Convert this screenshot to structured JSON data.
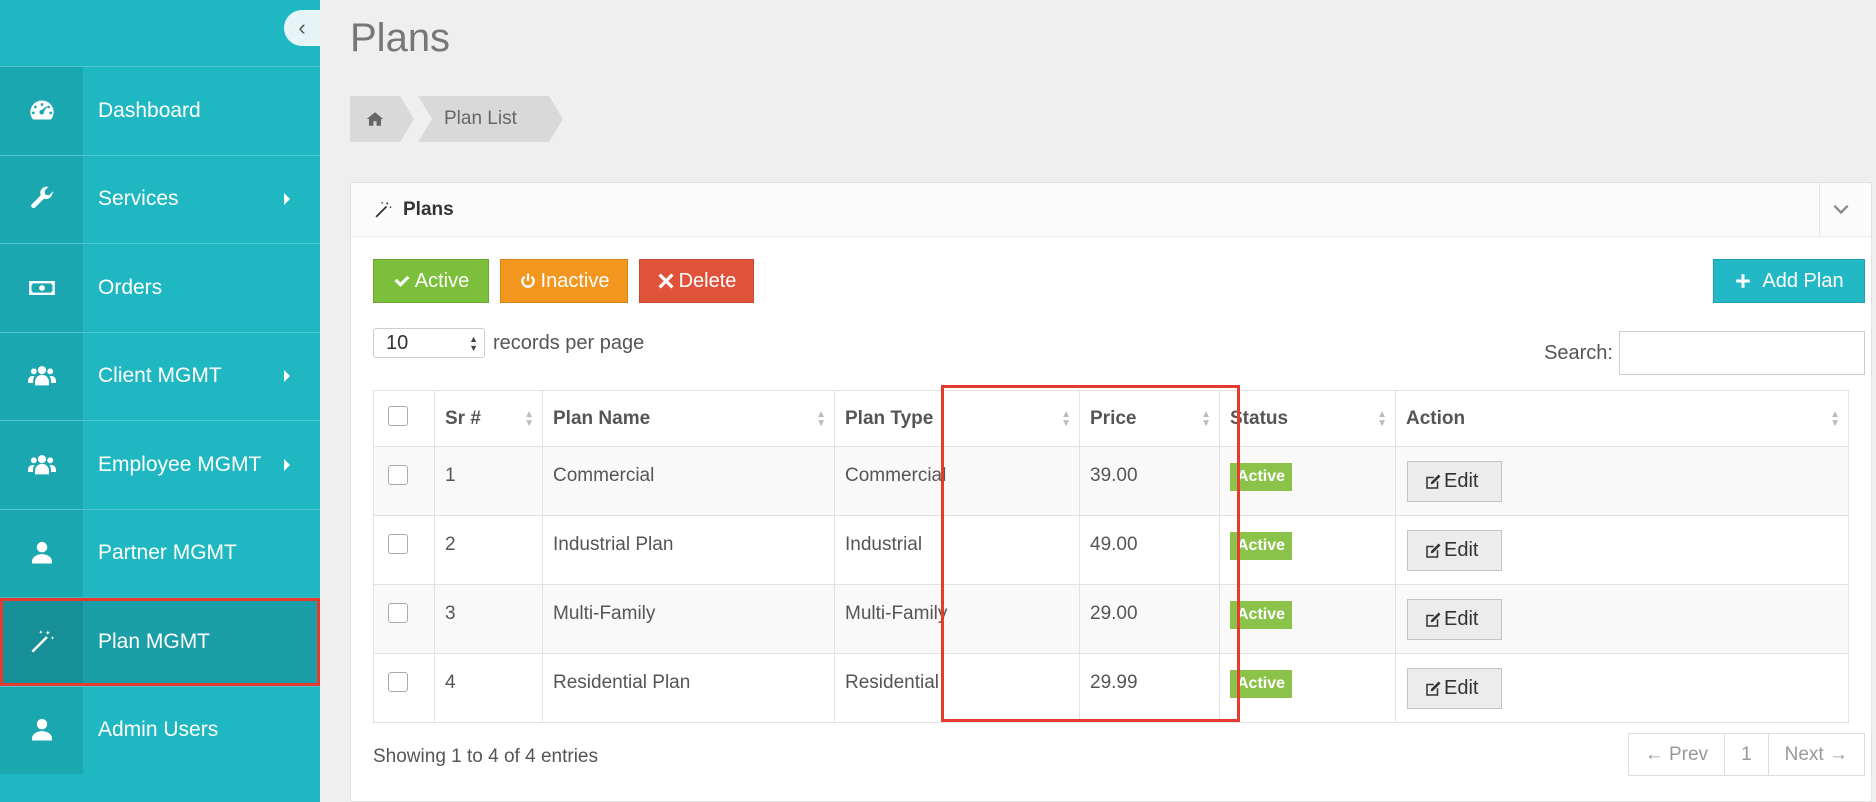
{
  "sidebar": {
    "items": [
      {
        "label": "Dashboard",
        "icon": "dashboard-icon"
      },
      {
        "label": "Services",
        "icon": "wrench-icon"
      },
      {
        "label": "Orders",
        "icon": "money-icon"
      },
      {
        "label": "Client MGMT",
        "icon": "users-icon"
      },
      {
        "label": "Employee MGMT",
        "icon": "users-icon"
      },
      {
        "label": "Partner MGMT",
        "icon": "user-icon"
      },
      {
        "label": "Plan MGMT",
        "icon": "magic-wand-icon"
      },
      {
        "label": "Admin Users",
        "icon": "user-icon"
      }
    ]
  },
  "page": {
    "title": "Plans",
    "breadcrumb": "Plan List"
  },
  "panel": {
    "title": "Plans"
  },
  "toolbar": {
    "active_label": "Active",
    "inactive_label": "Inactive",
    "delete_label": "Delete",
    "add_label": "Add Plan"
  },
  "table_controls": {
    "records_value": "10",
    "records_label": "records per page",
    "search_label": "Search:"
  },
  "table": {
    "headers": {
      "sr": "Sr #",
      "name": "Plan Name",
      "type": "Plan Type",
      "price": "Price",
      "status": "Status",
      "action": "Action"
    },
    "rows": [
      {
        "sr": "1",
        "name": "Commercial",
        "type": "Commercial",
        "price": "39.00",
        "status": "Active",
        "action": "Edit"
      },
      {
        "sr": "2",
        "name": "Industrial Plan",
        "type": "Industrial",
        "price": "49.00",
        "status": "Active",
        "action": "Edit"
      },
      {
        "sr": "3",
        "name": "Multi-Family",
        "type": "Multi-Family",
        "price": "29.00",
        "status": "Active",
        "action": "Edit"
      },
      {
        "sr": "4",
        "name": "Residential Plan",
        "type": "Residential",
        "price": "29.99",
        "status": "Active",
        "action": "Edit"
      }
    ]
  },
  "footer": {
    "showing": "Showing 1 to 4 of 4 entries",
    "prev": "← Prev",
    "page": "1",
    "next": "Next →"
  },
  "colors": {
    "sidebar": "#1fb8c2",
    "highlight": "#e53a2e",
    "active_btn": "#7cbf3a",
    "inactive_btn": "#f2961d",
    "delete_btn": "#e1523b",
    "status_badge": "#8bc34a"
  }
}
